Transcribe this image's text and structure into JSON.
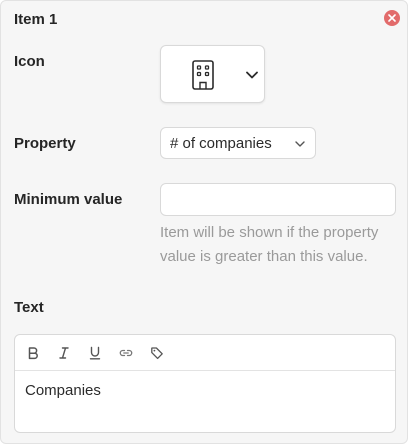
{
  "item": {
    "title": "Item 1"
  },
  "fields": {
    "icon_label": "Icon",
    "icon_selected": "building-icon",
    "property_label": "Property",
    "property_value": "# of companies",
    "min_value_label": "Minimum value",
    "min_value": "",
    "min_value_placeholder": "",
    "min_value_help": "Item will be shown if the property value is greater than this value.",
    "text_label": "Text"
  },
  "editor": {
    "toolbar": [
      "bold-icon",
      "italic-icon",
      "underline-icon",
      "link-icon",
      "tag-icon"
    ],
    "content": "Companies"
  },
  "colors": {
    "close_button": "#e26b6b",
    "panel_bg": "#f6f6f6",
    "help_text": "#9a9a9a"
  }
}
